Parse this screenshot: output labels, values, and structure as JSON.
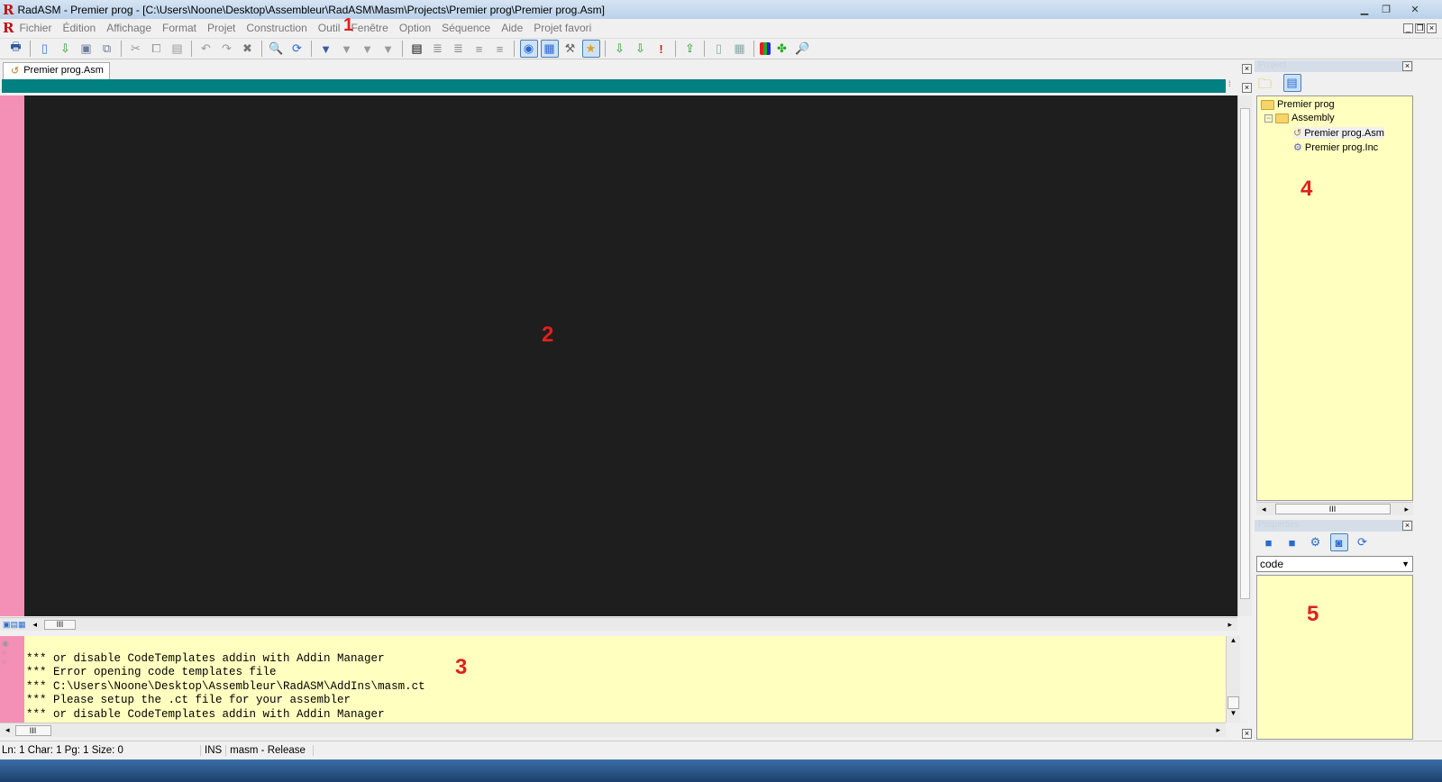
{
  "window": {
    "title": "RadASM - Premier prog - [C:\\Users\\Noone\\Desktop\\Assembleur\\RadASM\\Masm\\Projects\\Premier prog\\Premier prog.Asm]"
  },
  "menu": [
    "Fichier",
    "Édition",
    "Affichage",
    "Format",
    "Projet",
    "Construction",
    "Outil",
    "Fenêtre",
    "Option",
    "Séquence",
    "Aide",
    "Projet favori"
  ],
  "tab": {
    "label": "Premier prog.Asm"
  },
  "output": {
    "lines": [
      "*** or disable CodeTemplates addin with Addin Manager",
      "*** Error opening code templates file",
      "*** C:\\Users\\Noone\\Desktop\\Assembleur\\RadASM\\AddIns\\masm.ct",
      "*** Please setup the .ct file for your assembler",
      "*** or disable CodeTemplates addin with Addin Manager"
    ]
  },
  "project": {
    "header": "Project",
    "tree": {
      "root": "Premier prog",
      "group": "Assembly",
      "files": [
        "Premier prog.Asm",
        "Premier prog.Inc"
      ]
    }
  },
  "properties": {
    "header": "Properties",
    "select_value": "code"
  },
  "status": {
    "position": "Ln: 1 Char: 1 Pg: 1 Size: 0",
    "mode": "INS",
    "build": "masm - Release"
  },
  "annotations": [
    "1",
    "2",
    "3",
    "4",
    "5"
  ]
}
